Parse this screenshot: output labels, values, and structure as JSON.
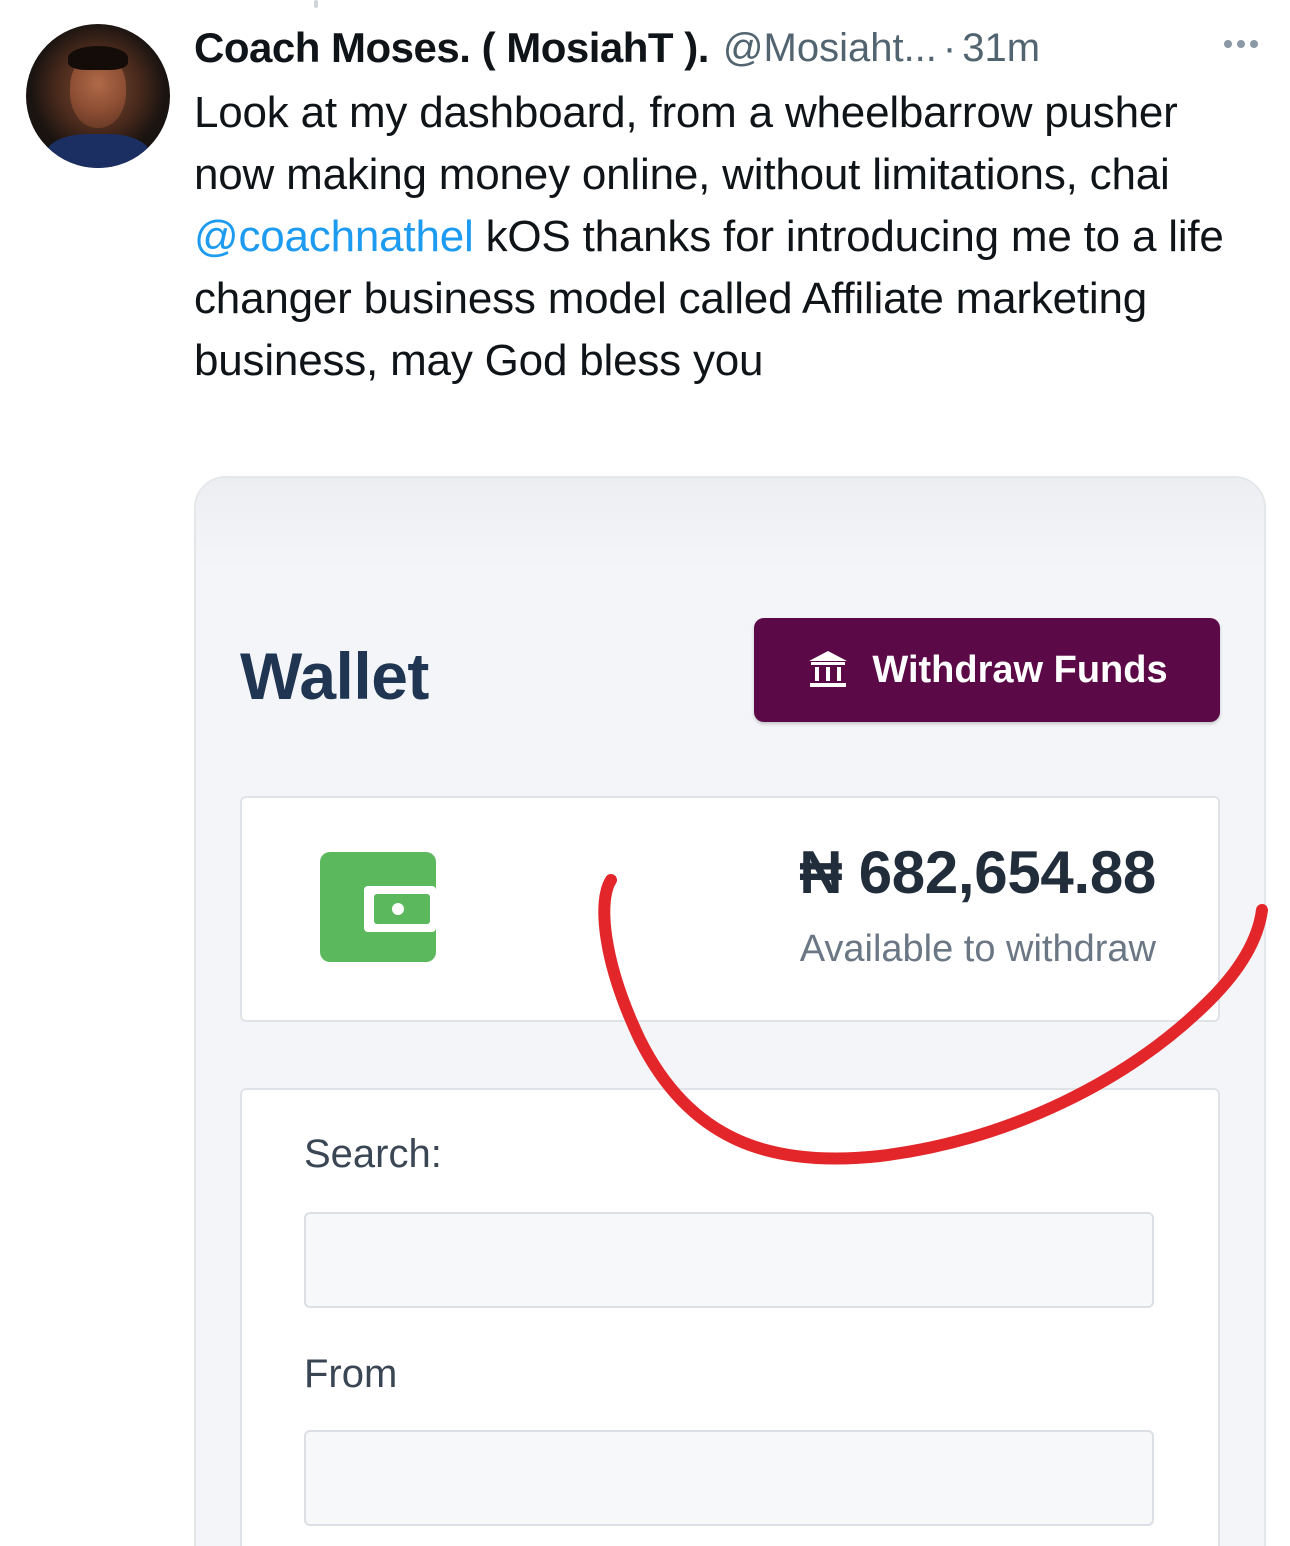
{
  "tweet": {
    "author": {
      "display_name": "Coach Moses. ( MosiahT ).",
      "handle": "@Mosiaht...",
      "separator": "·",
      "time": "31m"
    },
    "more_icon": "more-dots-icon",
    "text": {
      "part1": "Look at my dashboard, from a wheelbarrow pusher now making money online, without limitations, chai ",
      "mention": "@coachnathel",
      "part2": " kOS thanks for introducing me to a life changer business model called Affiliate marketing business, may God bless you"
    }
  },
  "media": {
    "wallet_title": "Wallet",
    "withdraw_button": {
      "label": "Withdraw Funds",
      "icon": "bank-icon",
      "color": "#5c0a47"
    },
    "balance": {
      "amount": "₦ 682,654.88",
      "caption": "Available to withdraw",
      "icon": "wallet-icon",
      "icon_color": "#5cb85c"
    },
    "filters": {
      "search_label": "Search:",
      "search_value": "",
      "from_label": "From",
      "from_value": ""
    },
    "annotation_color": "#e3262a"
  }
}
